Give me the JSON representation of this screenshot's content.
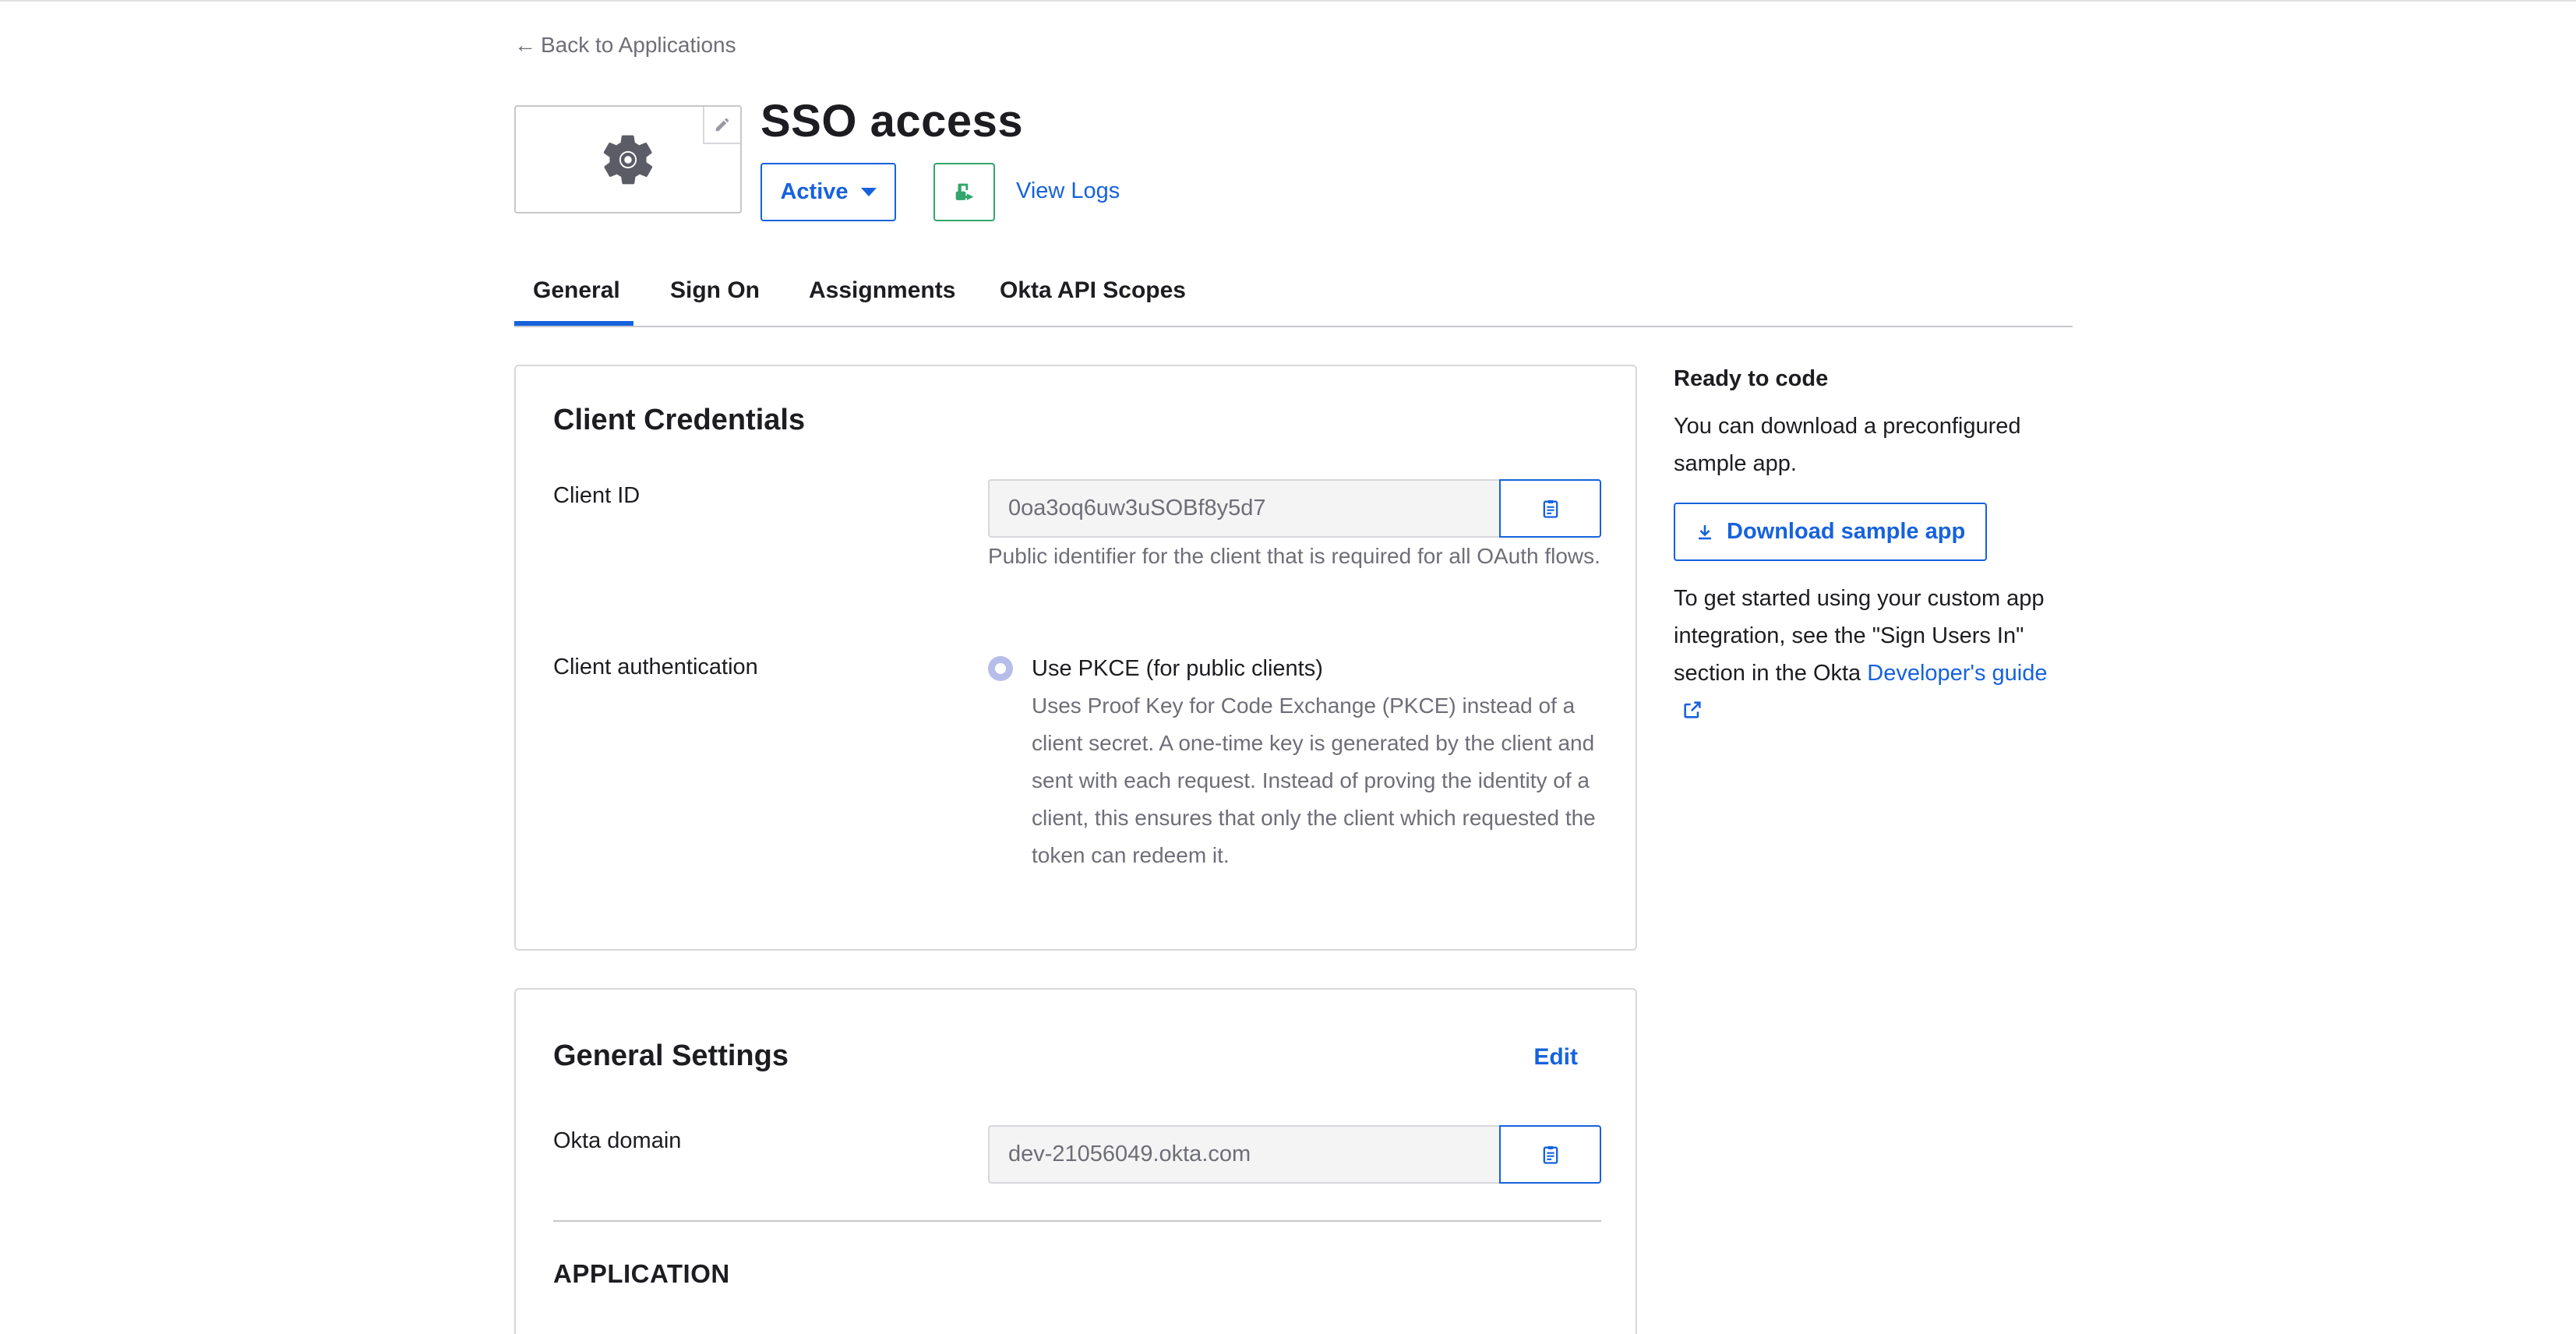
{
  "nav": {
    "back_label": "Back to Applications"
  },
  "app": {
    "title": "SSO access",
    "status": "Active",
    "view_logs": "View Logs"
  },
  "tabs": [
    {
      "label": "General",
      "active": true
    },
    {
      "label": "Sign On",
      "active": false
    },
    {
      "label": "Assignments",
      "active": false
    },
    {
      "label": "Okta API Scopes",
      "active": false
    }
  ],
  "credentials": {
    "title": "Client Credentials",
    "client_id_label": "Client ID",
    "client_id_value": "0oa3oq6uw3uSOBf8y5d7",
    "client_id_help": "Public identifier for the client that is required for all OAuth flows.",
    "auth_label": "Client authentication",
    "pkce_option": "Use PKCE (for public clients)",
    "pkce_desc": "Uses Proof Key for Code Exchange (PKCE) instead of a client secret. A one-time key is generated by the client and sent with each request. Instead of proving the identity of a client, this ensures that only the client which requested the token can redeem it.",
    "pkce_selected": true
  },
  "general_settings": {
    "title": "General Settings",
    "edit_label": "Edit",
    "okta_domain_label": "Okta domain",
    "okta_domain_value": "dev-21056049.okta.com",
    "section_application": "APPLICATION"
  },
  "sidebar": {
    "title": "Ready to code",
    "intro": "You can download a preconfigured sample app.",
    "download_label": "Download sample app",
    "guide_text": "To get started using your custom app integration, see the \"Sign Users In\" section in the Okta",
    "guide_link": "Developer's guide"
  },
  "colors": {
    "accent": "#1662dd",
    "push_green": "#32a66a",
    "muted_text": "#6e6e78",
    "border": "#d7d7dc"
  }
}
